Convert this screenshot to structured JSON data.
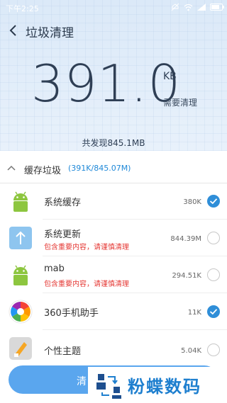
{
  "status_bar": {
    "time": "下午2:25"
  },
  "header": {
    "title": "垃圾清理",
    "big_value": "391.0",
    "unit": "KB",
    "subtitle": "需要清理",
    "found_text": "共发现845.1MB"
  },
  "section": {
    "title": "缓存垃圾",
    "count": "(391K/845.07M)"
  },
  "items": [
    {
      "icon": "android-icon",
      "title": "系统缓存",
      "warning": "",
      "size": "380K",
      "checked": true
    },
    {
      "icon": "upload-arrow-icon",
      "title": "系统更新",
      "warning": "包含重要内容，请谨慎清理",
      "size": "844.39M",
      "checked": false
    },
    {
      "icon": "android-icon",
      "title": "mab",
      "warning": "包含重要内容，请谨慎清理",
      "size": "294.51K",
      "checked": false
    },
    {
      "icon": "360-assistant-icon",
      "title": "360手机助手",
      "warning": "",
      "size": "11K",
      "checked": true
    },
    {
      "icon": "theme-icon",
      "title": "个性主题",
      "warning": "",
      "size": "5.04K",
      "checked": false
    }
  ],
  "clean_button": {
    "label": "清"
  },
  "watermark": {
    "text": "粉蝶数码"
  },
  "colors": {
    "accent": "#2f8ed8",
    "warning": "#e53935",
    "header_bg": "#dbe9f8"
  }
}
